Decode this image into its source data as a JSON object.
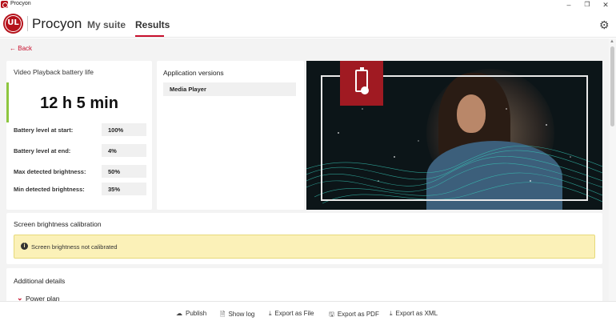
{
  "window": {
    "title": "Procyon",
    "min_glyph": "–",
    "max_glyph": "❐",
    "close_glyph": "✕",
    "icon": "procyon-app-icon"
  },
  "header": {
    "logo_text": "UL",
    "product": "Procyon",
    "nav": [
      {
        "label": "My suite"
      },
      {
        "label": "Results",
        "active": true
      }
    ],
    "settings_icon": "gear-icon",
    "settings_glyph": "⚙",
    "accent_color": "#c8102e"
  },
  "back": {
    "label": "Back",
    "glyph": "←"
  },
  "battery": {
    "title": "Video Playback battery life",
    "result": "12 h 5 min",
    "accent_color": "#8dc63f",
    "stats": [
      {
        "label": "Battery level at start:",
        "value": "100%"
      },
      {
        "label": "Battery level at end:",
        "value": "4%"
      },
      {
        "label": "Max detected brightness:",
        "value": "50%"
      },
      {
        "label": "Min detected brightness:",
        "value": "35%"
      }
    ]
  },
  "versions": {
    "title": "Application versions",
    "items": [
      {
        "name": "Media Player"
      }
    ]
  },
  "hero": {
    "badge_icon": "battery-icon",
    "badge_color": "#a01a22"
  },
  "calibration": {
    "title": "Screen brightness calibration",
    "warning": "Screen brightness not calibrated",
    "warning_icon": "info-icon",
    "warning_glyph": "i",
    "warning_bg": "#fbf1b8"
  },
  "details": {
    "title": "Additional details",
    "section": "Power plan",
    "section_glyph": "⌄"
  },
  "footer": {
    "actions": [
      {
        "label": "Publish",
        "icon": "cloud-upload-icon",
        "glyph": "☁"
      },
      {
        "label": "Show log",
        "icon": "document-icon",
        "glyph": "🗎"
      },
      {
        "label": "Export as File",
        "icon": "download-icon",
        "glyph": "⤓"
      },
      {
        "label": "Export as PDF",
        "icon": "save-icon",
        "glyph": "🖫"
      },
      {
        "label": "Export as XML",
        "icon": "download-icon",
        "glyph": "⤓"
      }
    ]
  }
}
